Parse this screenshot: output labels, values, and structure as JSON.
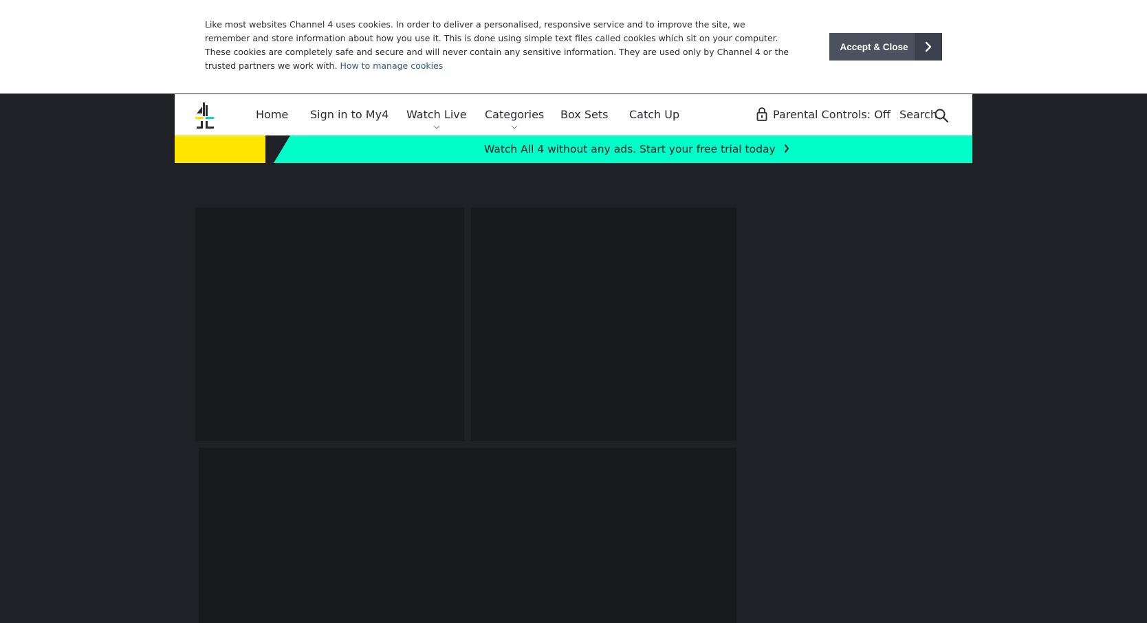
{
  "cookie_banner": {
    "text": "Like most websites Channel 4 uses cookies. In order to deliver a personalised, responsive service and to improve the site, we remember and store information about how you use it. This is done using simple text files called cookies which sit on your computer. These cookies are completely safe and secure and will never contain any sensitive information. They are used only by Channel 4 or the trusted partners we work with.",
    "link_label": "How to manage cookies",
    "accept_label": "Accept & Close"
  },
  "nav": {
    "items": [
      {
        "label": "Home"
      },
      {
        "label": "Sign in to My4"
      },
      {
        "label": "Watch Live"
      },
      {
        "label": "Categories"
      },
      {
        "label": "Box Sets"
      },
      {
        "label": "Catch Up"
      }
    ],
    "parental_controls": "Parental Controls: Off",
    "search_label": "Search"
  },
  "promo": {
    "text": "Watch All 4 without any ads. Start your free trial today"
  },
  "colors": {
    "page_background": "#1f2126",
    "promo_teal": "#00ffc8",
    "promo_yellow": "#ffe600",
    "accept_button": "#4a5260",
    "tile_background": "#18191c"
  }
}
